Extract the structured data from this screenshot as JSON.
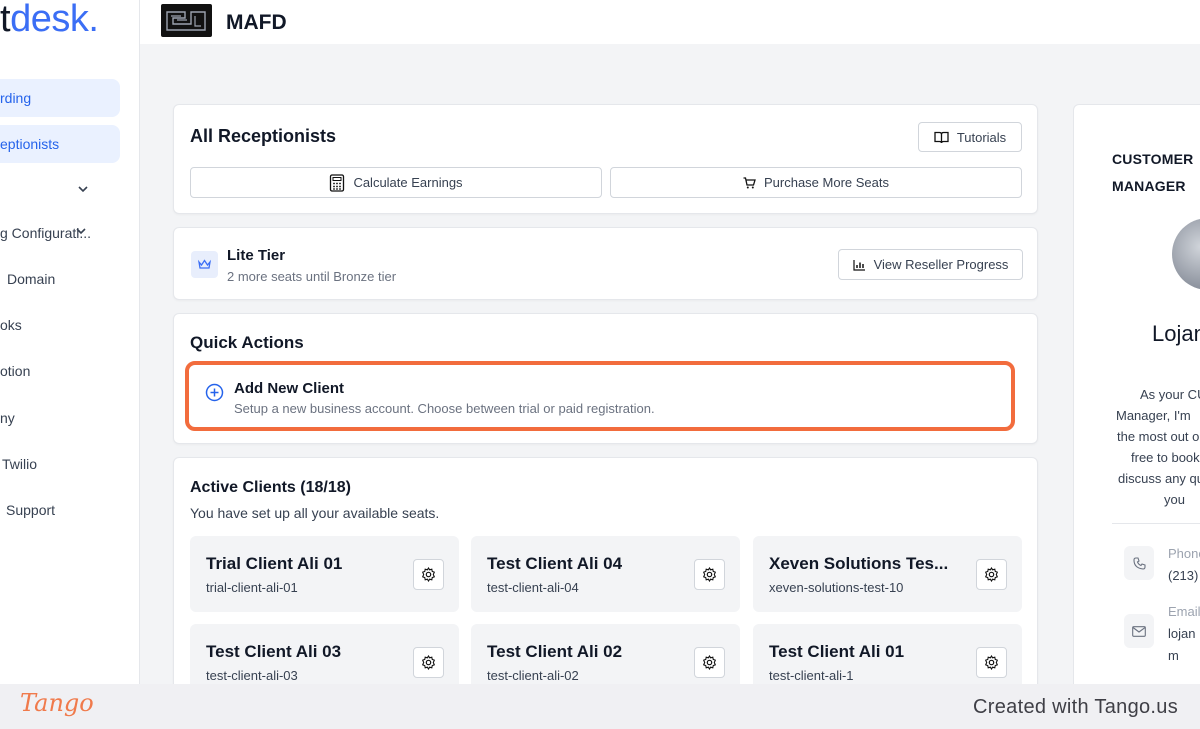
{
  "sidebar": {
    "logo_main": "t",
    "logo_accent": "desk.",
    "items": [
      {
        "label": "rding",
        "active": true
      },
      {
        "label": "eptionists",
        "active": true
      },
      {
        "label": "",
        "active": false
      },
      {
        "label": "g Configurati...",
        "active": false
      },
      {
        "label": "Domain",
        "active": false
      },
      {
        "label": "oks",
        "active": false
      },
      {
        "label": "otion",
        "active": false
      },
      {
        "label": "ny",
        "active": false
      },
      {
        "label": "Twilio",
        "active": false
      },
      {
        "label": "Support",
        "active": false
      }
    ]
  },
  "header": {
    "org_name": "MAFD"
  },
  "receptionists": {
    "title": "All Receptionists",
    "tutorials_label": "Tutorials",
    "calculate_label": "Calculate Earnings",
    "purchase_label": "Purchase More Seats"
  },
  "tier": {
    "name": "Lite Tier",
    "subtitle": "2 more seats until Bronze tier",
    "progress_label": "View Reseller Progress"
  },
  "quick_actions": {
    "title": "Quick Actions",
    "add_title": "Add New Client",
    "add_desc": "Setup a new business account. Choose between trial or paid registration."
  },
  "active_clients": {
    "title": "Active Clients (18/18)",
    "subtitle": "You have set up all your available seats.",
    "clients": [
      {
        "name": "Trial Client Ali 01",
        "slug": "trial-client-ali-01"
      },
      {
        "name": "Test Client Ali 04",
        "slug": "test-client-ali-04"
      },
      {
        "name": "Xeven Solutions Tes...",
        "slug": "xeven-solutions-test-10"
      },
      {
        "name": "Test Client Ali 03",
        "slug": "test-client-ali-03"
      },
      {
        "name": "Test Client Ali 02",
        "slug": "test-client-ali-02"
      },
      {
        "name": "Test Client Ali 01",
        "slug": "test-client-ali-1"
      }
    ]
  },
  "manager": {
    "title_line1": "CUSTOMER",
    "title_line2": "MANAGER",
    "name": "Lojan",
    "bio": [
      "As your CU",
      "Manager, I'm",
      "the most out o",
      "free to book",
      "discuss any qu",
      "you"
    ],
    "phone_label": "Phone",
    "phone_value": "(213)",
    "email_label": "Email",
    "email_value": "lojan",
    "email_value2": "m"
  },
  "footer": {
    "brand": "Tango",
    "created": "Created with Tango.us"
  },
  "colors": {
    "accent": "#3b6ef5",
    "highlight": "#f26c3d",
    "nav_active_bg": "#eaf1ff"
  }
}
